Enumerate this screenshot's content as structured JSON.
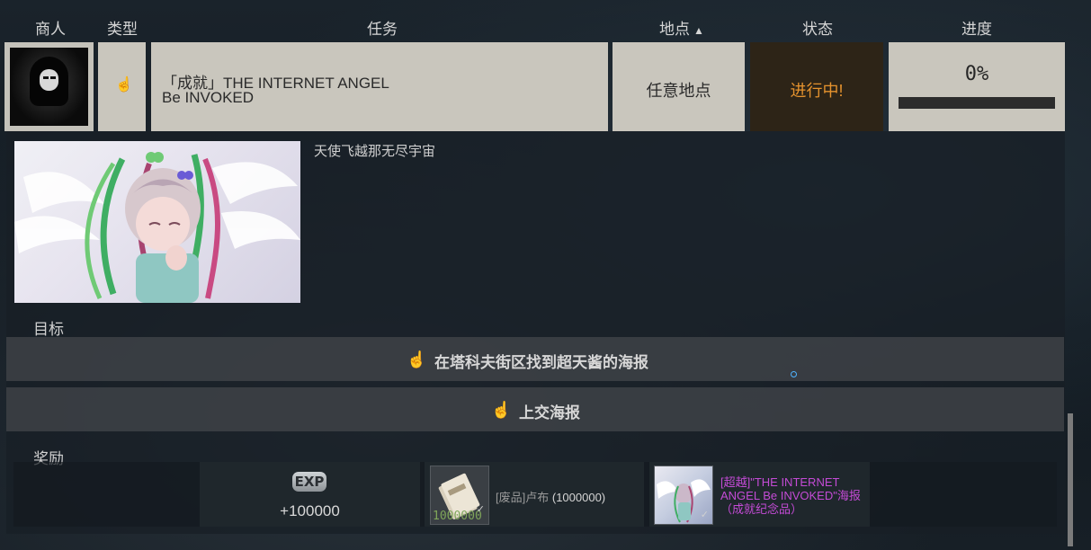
{
  "header": {
    "trader": "商人",
    "type": "类型",
    "task": "任务",
    "location": "地点",
    "status": "状态",
    "progress": "进度"
  },
  "quest": {
    "title_line1": "「成就」THE INTERNET ANGEL",
    "title_line2": "Be INVOKED",
    "location": "任意地点",
    "status": "进行中!",
    "progress_text": "0%",
    "progress_fraction": 0,
    "status_color": "#e6932e"
  },
  "detail": {
    "description": "天使飞越那无尽宇宙",
    "objectives_label": "目标",
    "objectives": [
      "在塔科夫街区找到超天酱的海报",
      "上交海报"
    ],
    "rewards_label": "奖励"
  },
  "rewards": {
    "exp_badge": "EXP",
    "exp_value": "+100000",
    "item_count": "1000000",
    "item_name_prefix": "[废品]卢布",
    "item_name_qty": "(1000000)",
    "poster_name": "[超越]\"THE INTERNET ANGEL Be INVOKED\"海报（成就纪念品）",
    "poster_color": "#c44bd6"
  },
  "icons": {
    "sort": "caret-up",
    "type": "hand-pointer",
    "objective": "hand-pointer"
  }
}
